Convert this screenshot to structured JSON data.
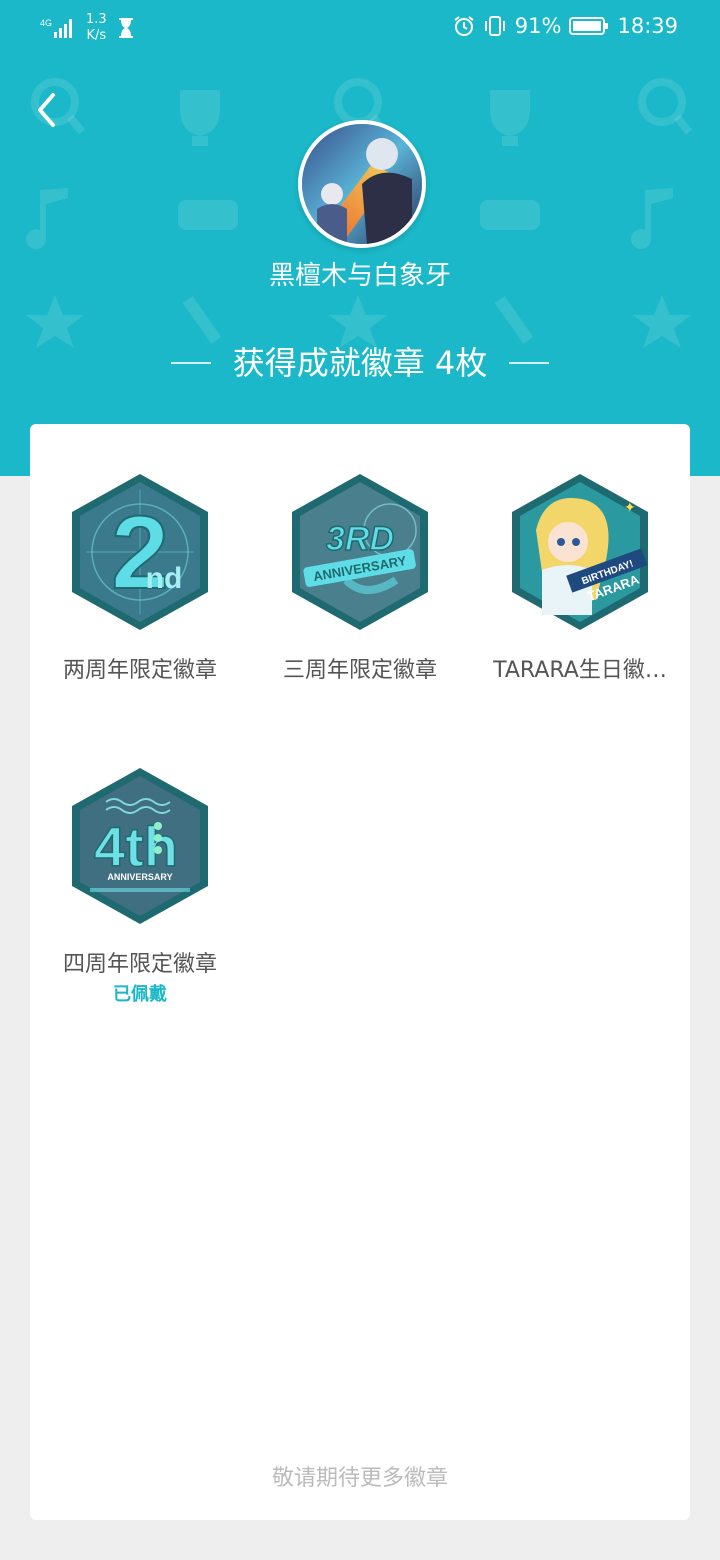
{
  "status_bar": {
    "network": "4G",
    "speed_value": "1.3",
    "speed_unit": "K/s",
    "battery": "91%",
    "time": "18:39"
  },
  "profile": {
    "username": "黑檀木与白象牙"
  },
  "section": {
    "title": "获得成就徽章 4枚"
  },
  "badges": [
    {
      "name": "两周年限定徽章",
      "art_text": "2nd",
      "status": ""
    },
    {
      "name": "三周年限定徽章",
      "art_text": "3RD ANNIVERSARY",
      "status": ""
    },
    {
      "name": "TARARA生日徽…",
      "art_text": "HAPPY BIRTHDAY! TARARA",
      "status": ""
    },
    {
      "name": "四周年限定徽章",
      "art_text": "4th ANNIVERSARY",
      "status": "已佩戴"
    }
  ],
  "footer": {
    "hint": "敬请期待更多徽章"
  },
  "colors": {
    "accent": "#1ab8c8",
    "badge_teal": "#1e7e82"
  }
}
